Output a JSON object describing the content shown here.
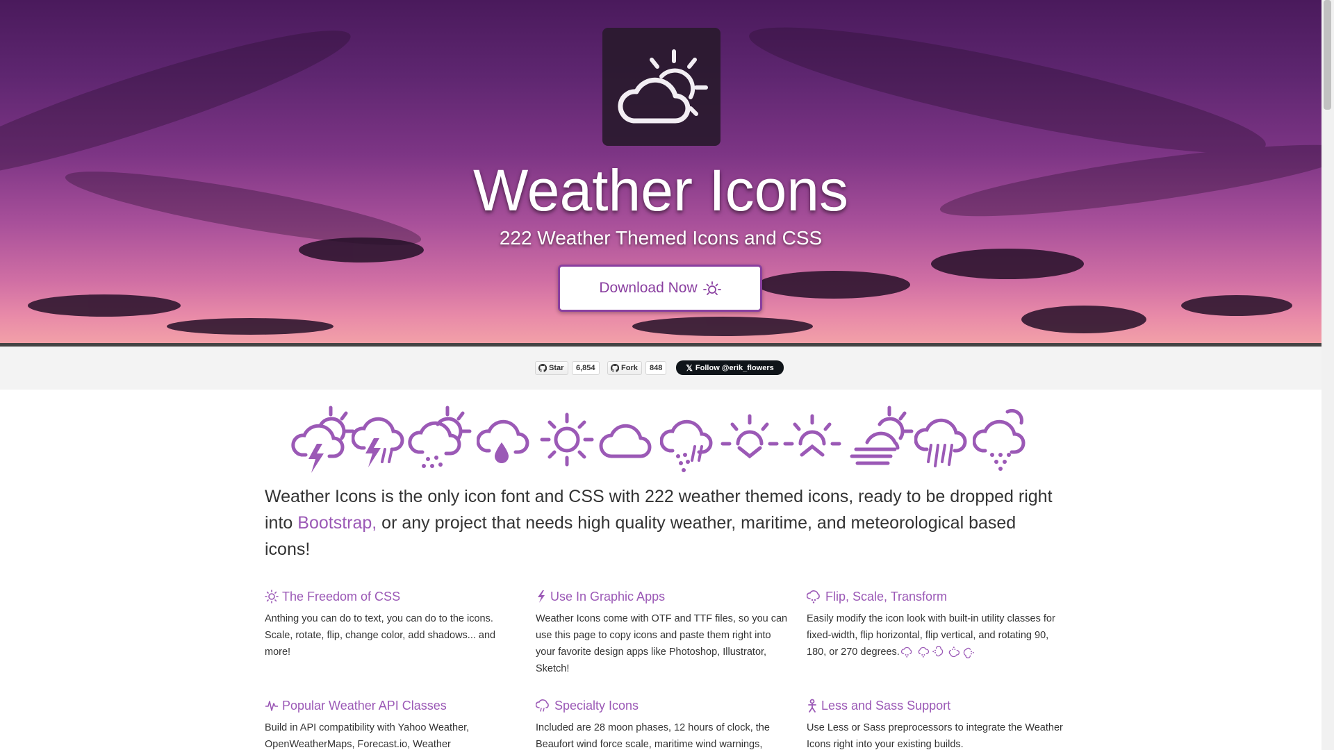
{
  "hero": {
    "title": "Weather Icons",
    "subtitle": "222 Weather Themed Icons and CSS",
    "download_label": "Download Now",
    "logo_icon": "day-cloudy-icon",
    "accent": "#9b59b6"
  },
  "social": {
    "star_label": "Star",
    "star_count": "6,854",
    "fork_label": "Fork",
    "fork_count": "848",
    "follow_label": "Follow @erik_flowers"
  },
  "icon_strip": [
    "day-thunderstorm-icon",
    "thunderstorm-icon",
    "day-sleet-icon",
    "raindrop-cloud-icon",
    "day-sunny-icon",
    "cloud-icon",
    "sleet-icon",
    "sunset-icon",
    "sunrise-icon",
    "day-fog-icon",
    "rain-icon",
    "snow-icon"
  ],
  "intro": {
    "before": "Weather Icons is the only icon font and CSS with 222 weather themed icons, ready to be dropped right into ",
    "link": "Bootstrap,",
    "after": " or any project that needs high quality weather, maritime, and meteorological based icons!"
  },
  "features": [
    {
      "title": "The Freedom of CSS",
      "icon": "day-sunny-icon",
      "desc": "Anthing you can do to text, you can do to the icons. Scale, rotate, flip, change color, add shadows... and more!"
    },
    {
      "title": "Use In Graphic Apps",
      "icon": "lightning-icon",
      "desc": "Weather Icons come with OTF and TTF files, so you can use this page to copy icons and paste them right into your favorite design apps like Photoshop, Illustrator, Sketch!"
    },
    {
      "title": "Flip, Scale, Transform",
      "icon": "hail-icon",
      "desc": "Easily modify the icon look with built-in utility classes for fixed-width, flip horizontal, flip vertical, and rotating 90, 180, or 270 degrees."
    },
    {
      "title": "Popular Weather API Classes",
      "icon": "pulse-icon",
      "desc": "Build in API compatibility with Yahoo Weather, OpenWeatherMaps, Forecast.io, Weather"
    },
    {
      "title": "Specialty Icons",
      "icon": "umbrella-cloud-icon",
      "desc": "Included are 28 moon phases, 12 hours of clock, the Beaufort wind force scale, maritime wind warnings,"
    },
    {
      "title": "Less and Sass Support",
      "icon": "person-icon",
      "desc": "Use Less or Sass preprocessors to integrate the Weather Icons right into your existing builds."
    }
  ]
}
